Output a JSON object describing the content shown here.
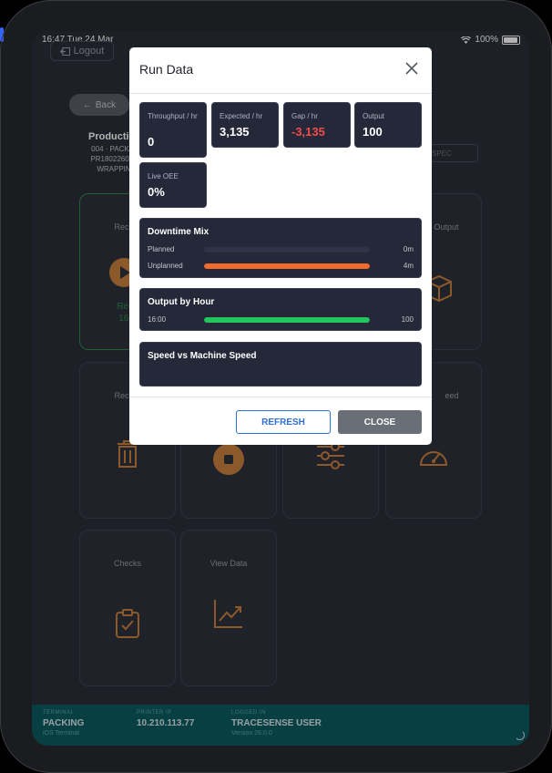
{
  "status": {
    "time": "16:47",
    "date": "Tue 24 Mar",
    "battery": "100%"
  },
  "header": {
    "logout": "Logout",
    "back": "Back"
  },
  "production": {
    "title": "Producti",
    "line1": "004 · PACKIN",
    "line2": "PR180226004",
    "line3": "WRAPPIN"
  },
  "spec_field": "SPEC",
  "tiles": {
    "record_start": {
      "label": "Record",
      "sub1": "Reco",
      "sub2": "16:2"
    },
    "output": {
      "label": "Output"
    },
    "record_waste": {
      "label": "Record"
    },
    "speed": {
      "label": "eed"
    },
    "checks": {
      "label": "Checks"
    },
    "view_data": {
      "label": "View Data"
    }
  },
  "footer": {
    "terminal_caption": "TERMINAL",
    "terminal": "PACKING",
    "terminal_sub": "iOS Terminal",
    "printer_caption": "PRINTER IP",
    "printer_ip": "10.210.113.77",
    "login_caption": "LOGGED IN",
    "user": "TRACESENSE USER",
    "version": "Version 26.0.0"
  },
  "modal": {
    "title": "Run Data",
    "stats": [
      {
        "caption": "Throughput / hr",
        "value": "0"
      },
      {
        "caption": "Expected / hr",
        "value": "3,135"
      },
      {
        "caption": "Gap / hr",
        "value": "-3,135"
      },
      {
        "caption": "Output",
        "value": "100"
      },
      {
        "caption": "Live OEE",
        "value": "0%"
      }
    ],
    "downtime": {
      "title": "Downtime Mix",
      "rows": [
        {
          "label": "Planned",
          "value": "0m",
          "fraction": 0,
          "color": "#2f3347"
        },
        {
          "label": "Unplanned",
          "value": "4m",
          "fraction": 1,
          "color": "#f26b2d"
        }
      ]
    },
    "output_hour": {
      "title": "Output by Hour",
      "rows": [
        {
          "label": "16:00",
          "value": "100",
          "fraction": 1,
          "color": "#22c55e"
        }
      ]
    },
    "speed": {
      "title": "Speed vs Machine Speed"
    },
    "buttons": {
      "refresh": "REFRESH",
      "close": "CLOSE"
    }
  },
  "colors": {
    "accent": "#2f6fd6",
    "negative": "#f24b4b",
    "teal_footer": "#0c5b60",
    "orange_icon": "#c9803d"
  }
}
